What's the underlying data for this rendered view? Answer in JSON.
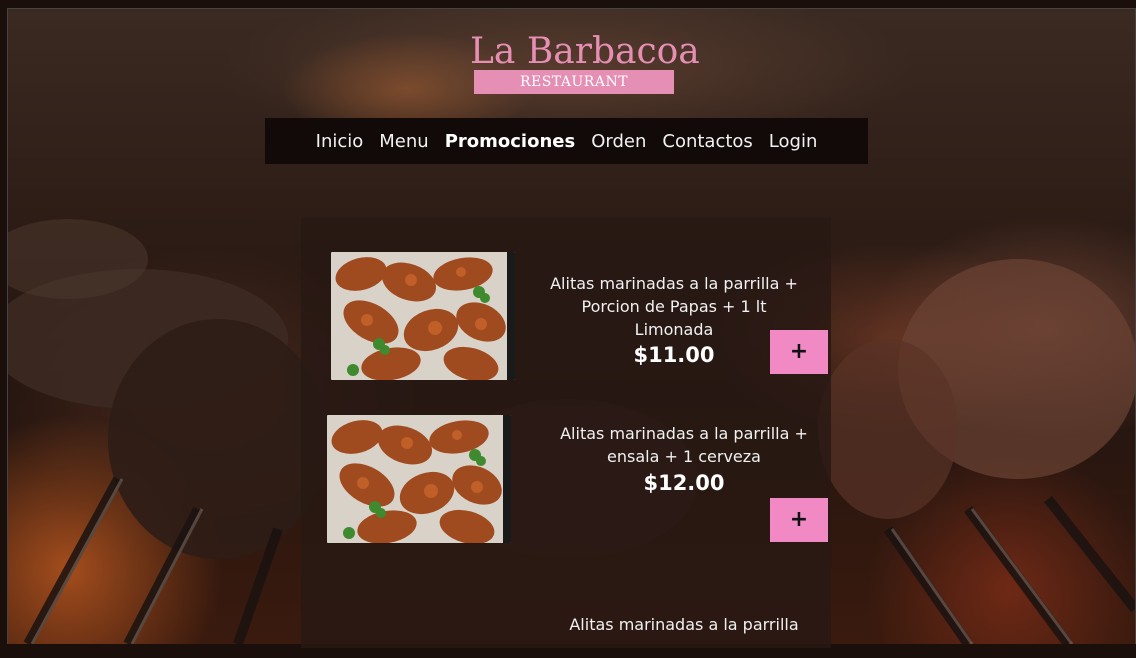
{
  "brand": {
    "name": "La Barbacoa",
    "tagline": "RESTAURANT",
    "accent_color": "#e58fb4"
  },
  "nav": {
    "items": [
      {
        "label": "Inicio",
        "active": false
      },
      {
        "label": "Menu",
        "active": false
      },
      {
        "label": "Promociones",
        "active": true
      },
      {
        "label": "Orden",
        "active": false
      },
      {
        "label": "Contactos",
        "active": false
      },
      {
        "label": "Login",
        "active": false
      }
    ]
  },
  "promotions": [
    {
      "description": "Alitas marinadas a la parrilla + Porcion de Papas + 1 lt Limonada",
      "price": "$11.00",
      "add_label": "+",
      "image_icon": "grilled-wings-image"
    },
    {
      "description": "Alitas marinadas a la parrilla + ensala + 1 cerveza",
      "price": "$12.00",
      "add_label": "+",
      "image_icon": "grilled-wings-image"
    },
    {
      "description": "Alitas marinadas a la parrilla",
      "price": "",
      "add_label": "",
      "image_icon": ""
    }
  ],
  "colors": {
    "button": "#f18ac4",
    "nav_bg": "#120909",
    "panel_bg": "#281814"
  }
}
